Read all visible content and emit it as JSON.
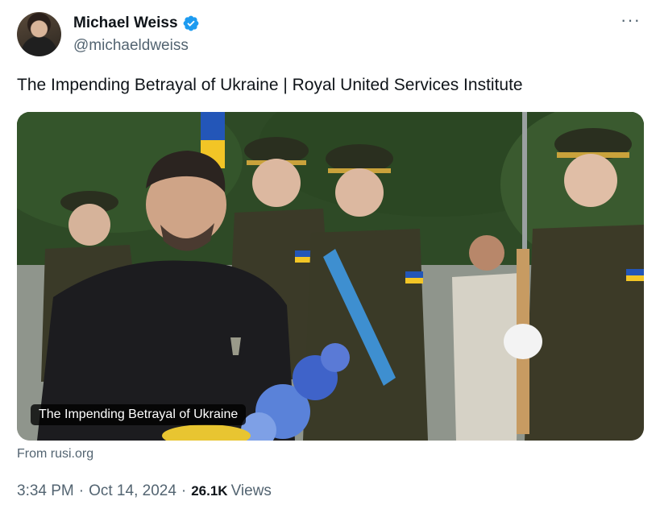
{
  "author": {
    "display_name": "Michael Weiss",
    "handle": "@michaeldweiss"
  },
  "tweet": {
    "text": "The Impending Betrayal of Ukraine | Royal United Services Institute"
  },
  "card": {
    "caption": "The Impending Betrayal of Ukraine",
    "source": "From rusi.org"
  },
  "meta": {
    "time": "3:34 PM",
    "separator": "·",
    "date": "Oct 14, 2024",
    "views_count": "26.1K",
    "views_label": "Views"
  },
  "icons": {
    "verified": "verified-badge-icon",
    "more": "more-horizontal-icon"
  },
  "colors": {
    "verified_blue": "#1d9bf0",
    "secondary_text": "#536471",
    "primary_text": "#0f1419"
  }
}
